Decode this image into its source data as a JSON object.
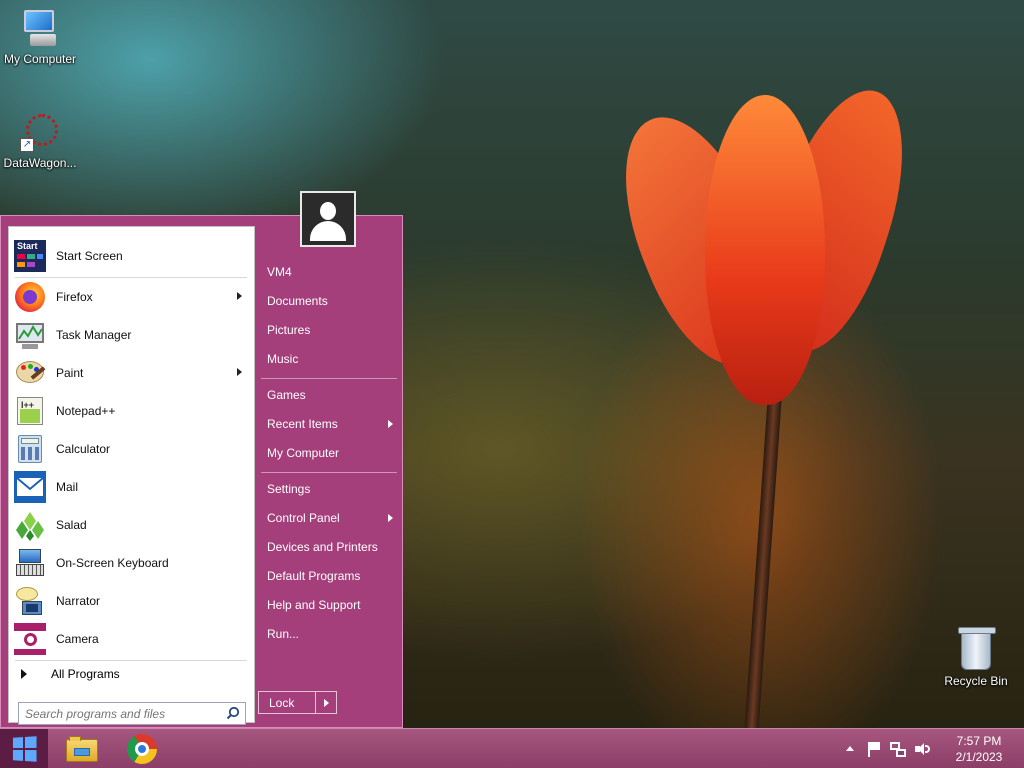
{
  "desktop": {
    "icons": {
      "my_computer": "My Computer",
      "datawagon": "DataWagon...",
      "recycle_bin": "Recycle Bin"
    }
  },
  "start_menu": {
    "programs": [
      {
        "label": "Start Screen",
        "icon": "start-screen-icon",
        "has_submenu": false
      },
      {
        "label": "Firefox",
        "icon": "firefox-icon",
        "has_submenu": true
      },
      {
        "label": "Task Manager",
        "icon": "task-manager-icon",
        "has_submenu": false
      },
      {
        "label": "Paint",
        "icon": "paint-icon",
        "has_submenu": true
      },
      {
        "label": "Notepad++",
        "icon": "notepad-plus-plus-icon",
        "has_submenu": false
      },
      {
        "label": "Calculator",
        "icon": "calculator-icon",
        "has_submenu": false
      },
      {
        "label": "Mail",
        "icon": "mail-icon",
        "has_submenu": false
      },
      {
        "label": "Salad",
        "icon": "salad-icon",
        "has_submenu": false
      },
      {
        "label": "On-Screen Keyboard",
        "icon": "keyboard-icon",
        "has_submenu": false
      },
      {
        "label": "Narrator",
        "icon": "narrator-icon",
        "has_submenu": false
      },
      {
        "label": "Camera",
        "icon": "camera-icon",
        "has_submenu": false
      }
    ],
    "start_screen_tile_text": "Start",
    "all_programs": "All Programs",
    "search_placeholder": "Search programs and files",
    "right": {
      "vm4": "VM4",
      "documents": "Documents",
      "pictures": "Pictures",
      "music": "Music",
      "games": "Games",
      "recent_items": "Recent Items",
      "my_computer": "My Computer",
      "settings": "Settings",
      "control_panel": "Control Panel",
      "devices_printers": "Devices and Printers",
      "default_programs": "Default Programs",
      "help_support": "Help and Support",
      "run": "Run..."
    },
    "lock": "Lock",
    "menu_color": "#a53f7c"
  },
  "taskbar": {
    "pinned": [
      "file-explorer-icon",
      "chrome-icon"
    ],
    "tray_icons": [
      "show-hidden-icons-chevron",
      "action-center-flag-icon",
      "network-icon",
      "volume-icon"
    ],
    "time": "7:57 PM",
    "date": "2/1/2023"
  }
}
